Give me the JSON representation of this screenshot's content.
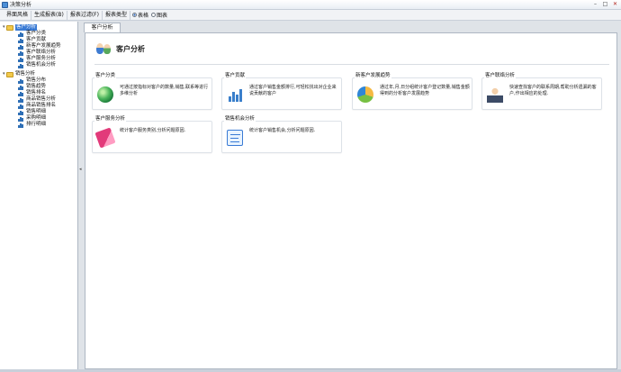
{
  "window": {
    "title": "决策分析",
    "controls": [
      "–",
      "□",
      "✕"
    ]
  },
  "menubar": {
    "items": [
      "界面风格",
      "生成报表(B)",
      "报表过滤(F)",
      "报表类型"
    ],
    "radio": [
      {
        "label": "表格",
        "selected": true
      },
      {
        "label": "图表",
        "selected": false
      }
    ]
  },
  "sidebar": {
    "groups": [
      {
        "label": "客户分析",
        "selected": true,
        "items": [
          "客户分类",
          "客户贡献",
          "新客户发展趋势",
          "客户联络分析",
          "客户服务分析",
          "销售机会分析"
        ]
      },
      {
        "label": "销售分析",
        "selected": false,
        "items": [
          "销售分布",
          "销售趋势",
          "销售排名",
          "商品销售分析",
          "商品销售排名",
          "销售明细",
          "采购明细",
          "排行明细"
        ]
      }
    ]
  },
  "main": {
    "tab": "客户分析",
    "page_title": "客户分析",
    "cards": [
      {
        "title": "客户分类",
        "desc": "可通过按指标对客户的数量,销售,联系等进行多维分析",
        "icon": "sphere-puzzle-icon"
      },
      {
        "title": "客户贡献",
        "desc": "通过客户销售金额排行,可轻松找出对企业来说贡献的客户",
        "icon": "bar-chart-icon"
      },
      {
        "title": "新客户发展趋势",
        "desc": "通过年,月,日分组统计客户登记数量,销售金额得到的分析客户发展趋势",
        "icon": "pie-chart-icon"
      },
      {
        "title": "客户联络分析",
        "desc": "快速查找客户的联系周期,帮助分析遗漏的客户,作出相应的处理.",
        "icon": "person-icon"
      },
      {
        "title": "客户服务分析",
        "desc": "统计客户服务类别,分析问题原因.",
        "icon": "book-icon"
      },
      {
        "title": "销售机会分析",
        "desc": "统计客户销售机会,分析问题原因.",
        "icon": "id-card-icon"
      }
    ]
  }
}
